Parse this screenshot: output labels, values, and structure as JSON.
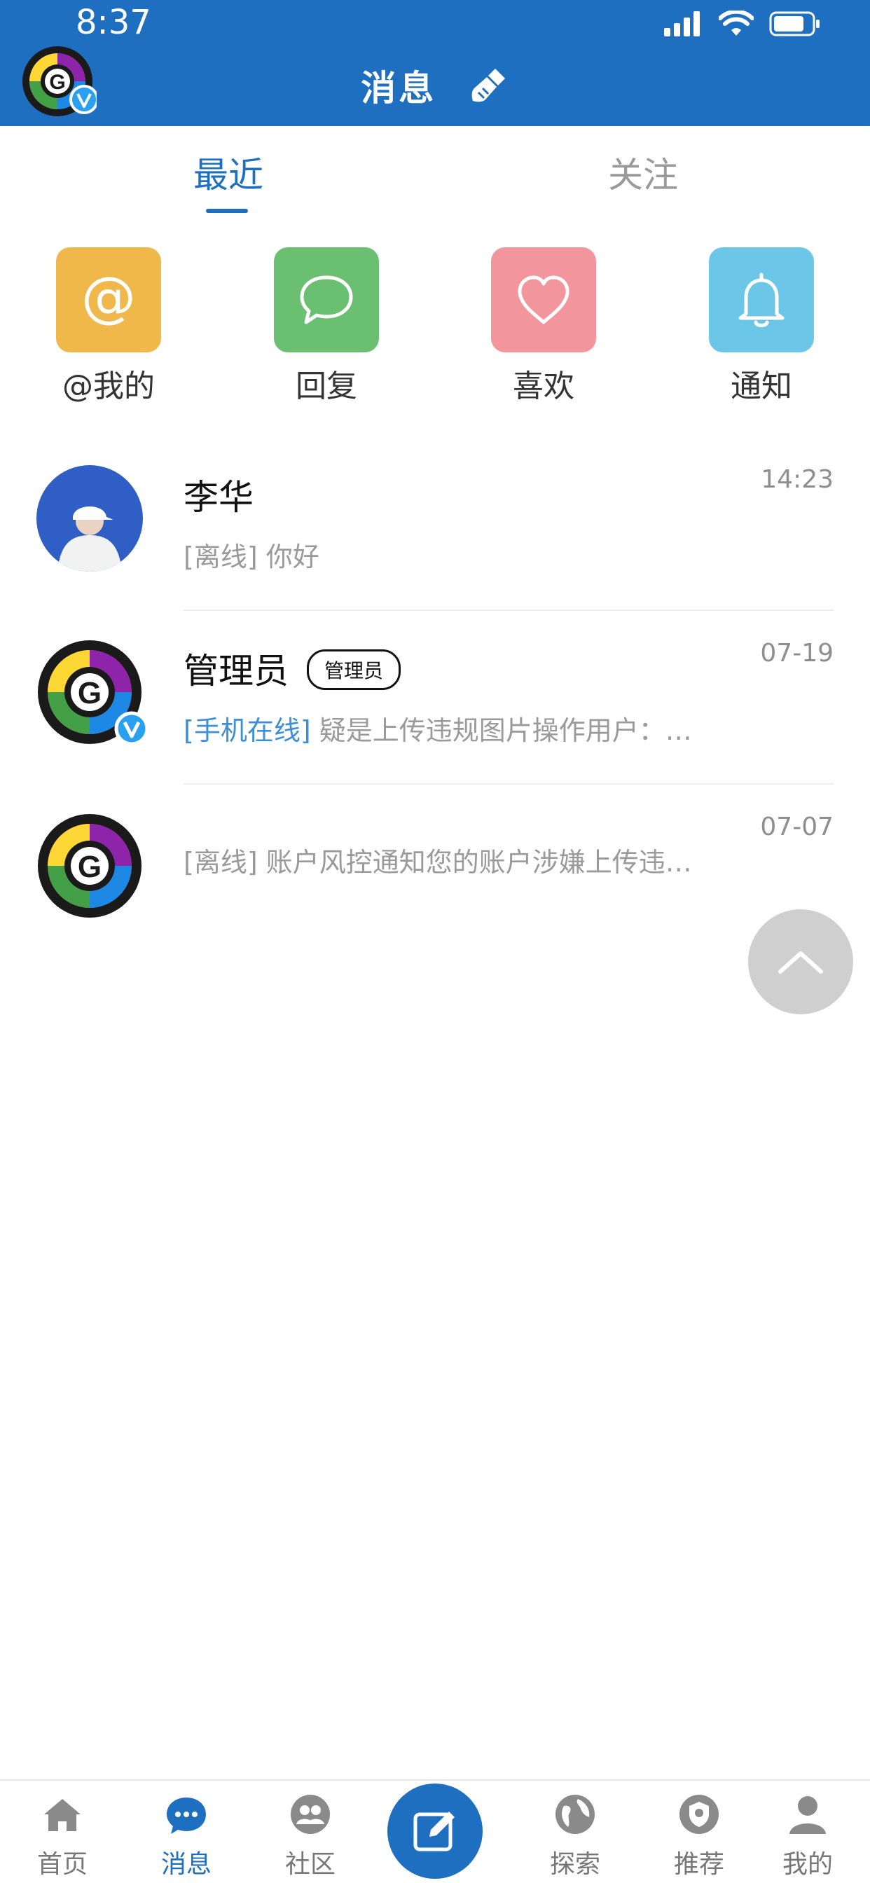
{
  "status": {
    "time": "8:37"
  },
  "header": {
    "title": "消息"
  },
  "tabs": [
    {
      "label": "最近",
      "active": true
    },
    {
      "label": "关注",
      "active": false
    }
  ],
  "shortcuts": [
    {
      "label": "@我的",
      "icon": "at-icon",
      "color": "#f0b84b"
    },
    {
      "label": "回复",
      "icon": "chat-bubble-icon",
      "color": "#6bbf70"
    },
    {
      "label": "喜欢",
      "icon": "heart-icon",
      "color": "#f3959d"
    },
    {
      "label": "通知",
      "icon": "bell-icon",
      "color": "#6cc6e7"
    }
  ],
  "messages": [
    {
      "name": "李华",
      "time": "14:23",
      "status": "[离线]",
      "preview": "你好"
    },
    {
      "name": "管理员",
      "tag": "管理员",
      "time": "07-19",
      "status": "[手机在线]",
      "preview": "疑是上传违规图片操作用户：人..."
    },
    {
      "name": "",
      "time": "07-07",
      "status": "[离线]",
      "preview": "账户风控通知您的账户涉嫌上传违规..."
    }
  ],
  "nav": [
    {
      "label": "首页",
      "icon": "home-icon",
      "active": false
    },
    {
      "label": "消息",
      "icon": "message-icon",
      "active": true
    },
    {
      "label": "社区",
      "icon": "community-icon",
      "active": false
    },
    {
      "label": "",
      "icon": "compose-icon",
      "active": false
    },
    {
      "label": "探索",
      "icon": "globe-icon",
      "active": false
    },
    {
      "label": "推荐",
      "icon": "shield-icon",
      "active": false
    },
    {
      "label": "我的",
      "icon": "user-icon",
      "active": false
    }
  ],
  "colors": {
    "brand": "#1e6fc0",
    "online": "#3c8ed6"
  }
}
